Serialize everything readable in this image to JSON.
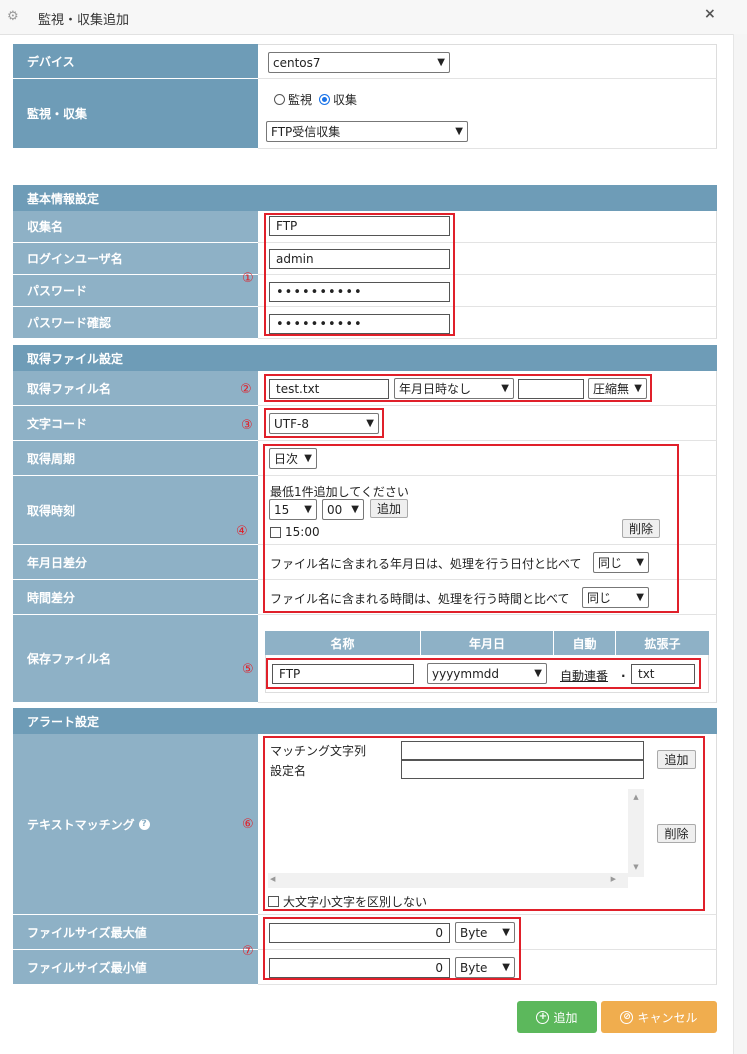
{
  "window": {
    "title": "監視・収集追加",
    "close": "×"
  },
  "device": {
    "label": "デバイス",
    "value": "centos7"
  },
  "monitor": {
    "label": "監視・収集",
    "radio_monitor": "監視",
    "radio_collect": "収集",
    "type_value": "FTP受信収集"
  },
  "basic": {
    "section": "基本情報設定",
    "name_label": "収集名",
    "name_value": "FTP",
    "user_label": "ログインユーザ名",
    "user_value": "admin",
    "pw_label": "パスワード",
    "pw_value": "••••••••••",
    "pw2_label": "パスワード確認",
    "pw2_value": "••••••••••",
    "marker": "①"
  },
  "file": {
    "section": "取得ファイル設定",
    "name_label": "取得ファイル名",
    "name_value": "test.txt",
    "date_format": "年月日時なし",
    "extra_value": "",
    "compress": "圧縮無",
    "marker2": "②",
    "charset_label": "文字コード",
    "charset_value": "UTF-8",
    "marker3": "③",
    "cycle_label": "取得周期",
    "cycle_value": "日次",
    "time_label": "取得時刻",
    "time_hint": "最低1件追加してください",
    "hour": "15",
    "minute": "00",
    "add": "追加",
    "entry": "15:00",
    "delete": "削除",
    "marker4": "④",
    "datediff_label": "年月日差分",
    "datediff_text": "ファイル名に含まれる年月日は、処理を行う日付と比べて",
    "datediff_value": "同じ",
    "timediff_label": "時間差分",
    "timediff_text": "ファイル名に含まれる時間は、処理を行う時間と比べて",
    "timediff_value": "同じ",
    "save_label": "保存ファイル名",
    "col_name": "名称",
    "col_date": "年月日",
    "col_auto": "自動",
    "col_ext": "拡張子",
    "save_name": "FTP",
    "save_date": "yyyymmdd",
    "save_auto": "自動連番",
    "dot": ".",
    "save_ext": "txt",
    "marker5": "⑤"
  },
  "alert": {
    "section": "アラート設定",
    "text_label": "テキストマッチング",
    "help": "?",
    "match_label": "マッチング文字列",
    "match_value": "",
    "setname_label": "設定名",
    "setname_value": "",
    "add": "追加",
    "delete": "削除",
    "case_label": "大文字小文字を区別しない",
    "marker6": "⑥",
    "max_label": "ファイルサイズ最大値",
    "max_value": "0",
    "max_unit": "Byte",
    "min_label": "ファイルサイズ最小値",
    "min_value": "0",
    "min_unit": "Byte",
    "marker7": "⑦"
  },
  "footer": {
    "add": "追加",
    "cancel": "キャンセル"
  },
  "colors": {
    "accent_red": "#e0202a",
    "label_bg": "#8eb1c6",
    "section_bg": "#6e9cb7",
    "add_green": "#5cb85c",
    "cancel_orange": "#f0ad4e"
  }
}
